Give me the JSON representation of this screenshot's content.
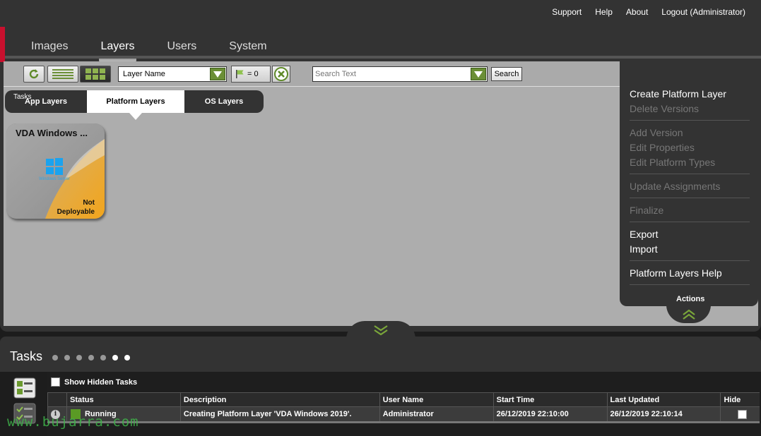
{
  "header": {
    "links": [
      "Support",
      "Help",
      "About",
      "Logout (Administrator)"
    ],
    "tabs": [
      {
        "label": "Images",
        "active": false
      },
      {
        "label": "Layers",
        "active": true
      },
      {
        "label": "Users",
        "active": false
      },
      {
        "label": "System",
        "active": false
      }
    ],
    "accent_color": "#c8102e"
  },
  "toolbar": {
    "sort_field": "Layer Name",
    "flag_count": "= 0",
    "search_placeholder": "Search Text",
    "search_label": "Search"
  },
  "subtabs": [
    {
      "label": "App Layers",
      "active": false
    },
    {
      "label": "Platform Layers",
      "active": true
    },
    {
      "label": "OS Layers",
      "active": false
    }
  ],
  "layer_tile": {
    "title": "VDA Windows ...",
    "logo_text": "Windows Server",
    "status_line1": "Not",
    "status_line2": "Deployable"
  },
  "actions": {
    "label": "Actions",
    "groups": [
      [
        {
          "label": "Create Platform Layer",
          "enabled": true
        },
        {
          "label": "Delete Versions",
          "enabled": false
        }
      ],
      [
        {
          "label": "Add Version",
          "enabled": false
        },
        {
          "label": "Edit Properties",
          "enabled": false
        },
        {
          "label": "Edit Platform Types",
          "enabled": false
        }
      ],
      [
        {
          "label": "Update Assignments",
          "enabled": false
        }
      ],
      [
        {
          "label": "Finalize",
          "enabled": false
        }
      ],
      [
        {
          "label": "Export",
          "enabled": true
        },
        {
          "label": "Import",
          "enabled": true
        }
      ],
      [
        {
          "label": "Platform Layers Help",
          "enabled": true
        }
      ]
    ]
  },
  "tasks": {
    "title": "Tasks",
    "side_label": "Tasks",
    "show_hidden_label": "Show Hidden Tasks",
    "columns": [
      "",
      "Status",
      "Description",
      "User Name",
      "Start Time",
      "Last Updated",
      "Hide"
    ],
    "rows": [
      {
        "status": "Running",
        "description": "Creating Platform Layer 'VDA Windows 2019'.",
        "user": "Administrator",
        "start": "26/12/2019 22:10:00",
        "updated": "26/12/2019 22:10:14"
      }
    ]
  },
  "watermark": "www.bujarra.com"
}
